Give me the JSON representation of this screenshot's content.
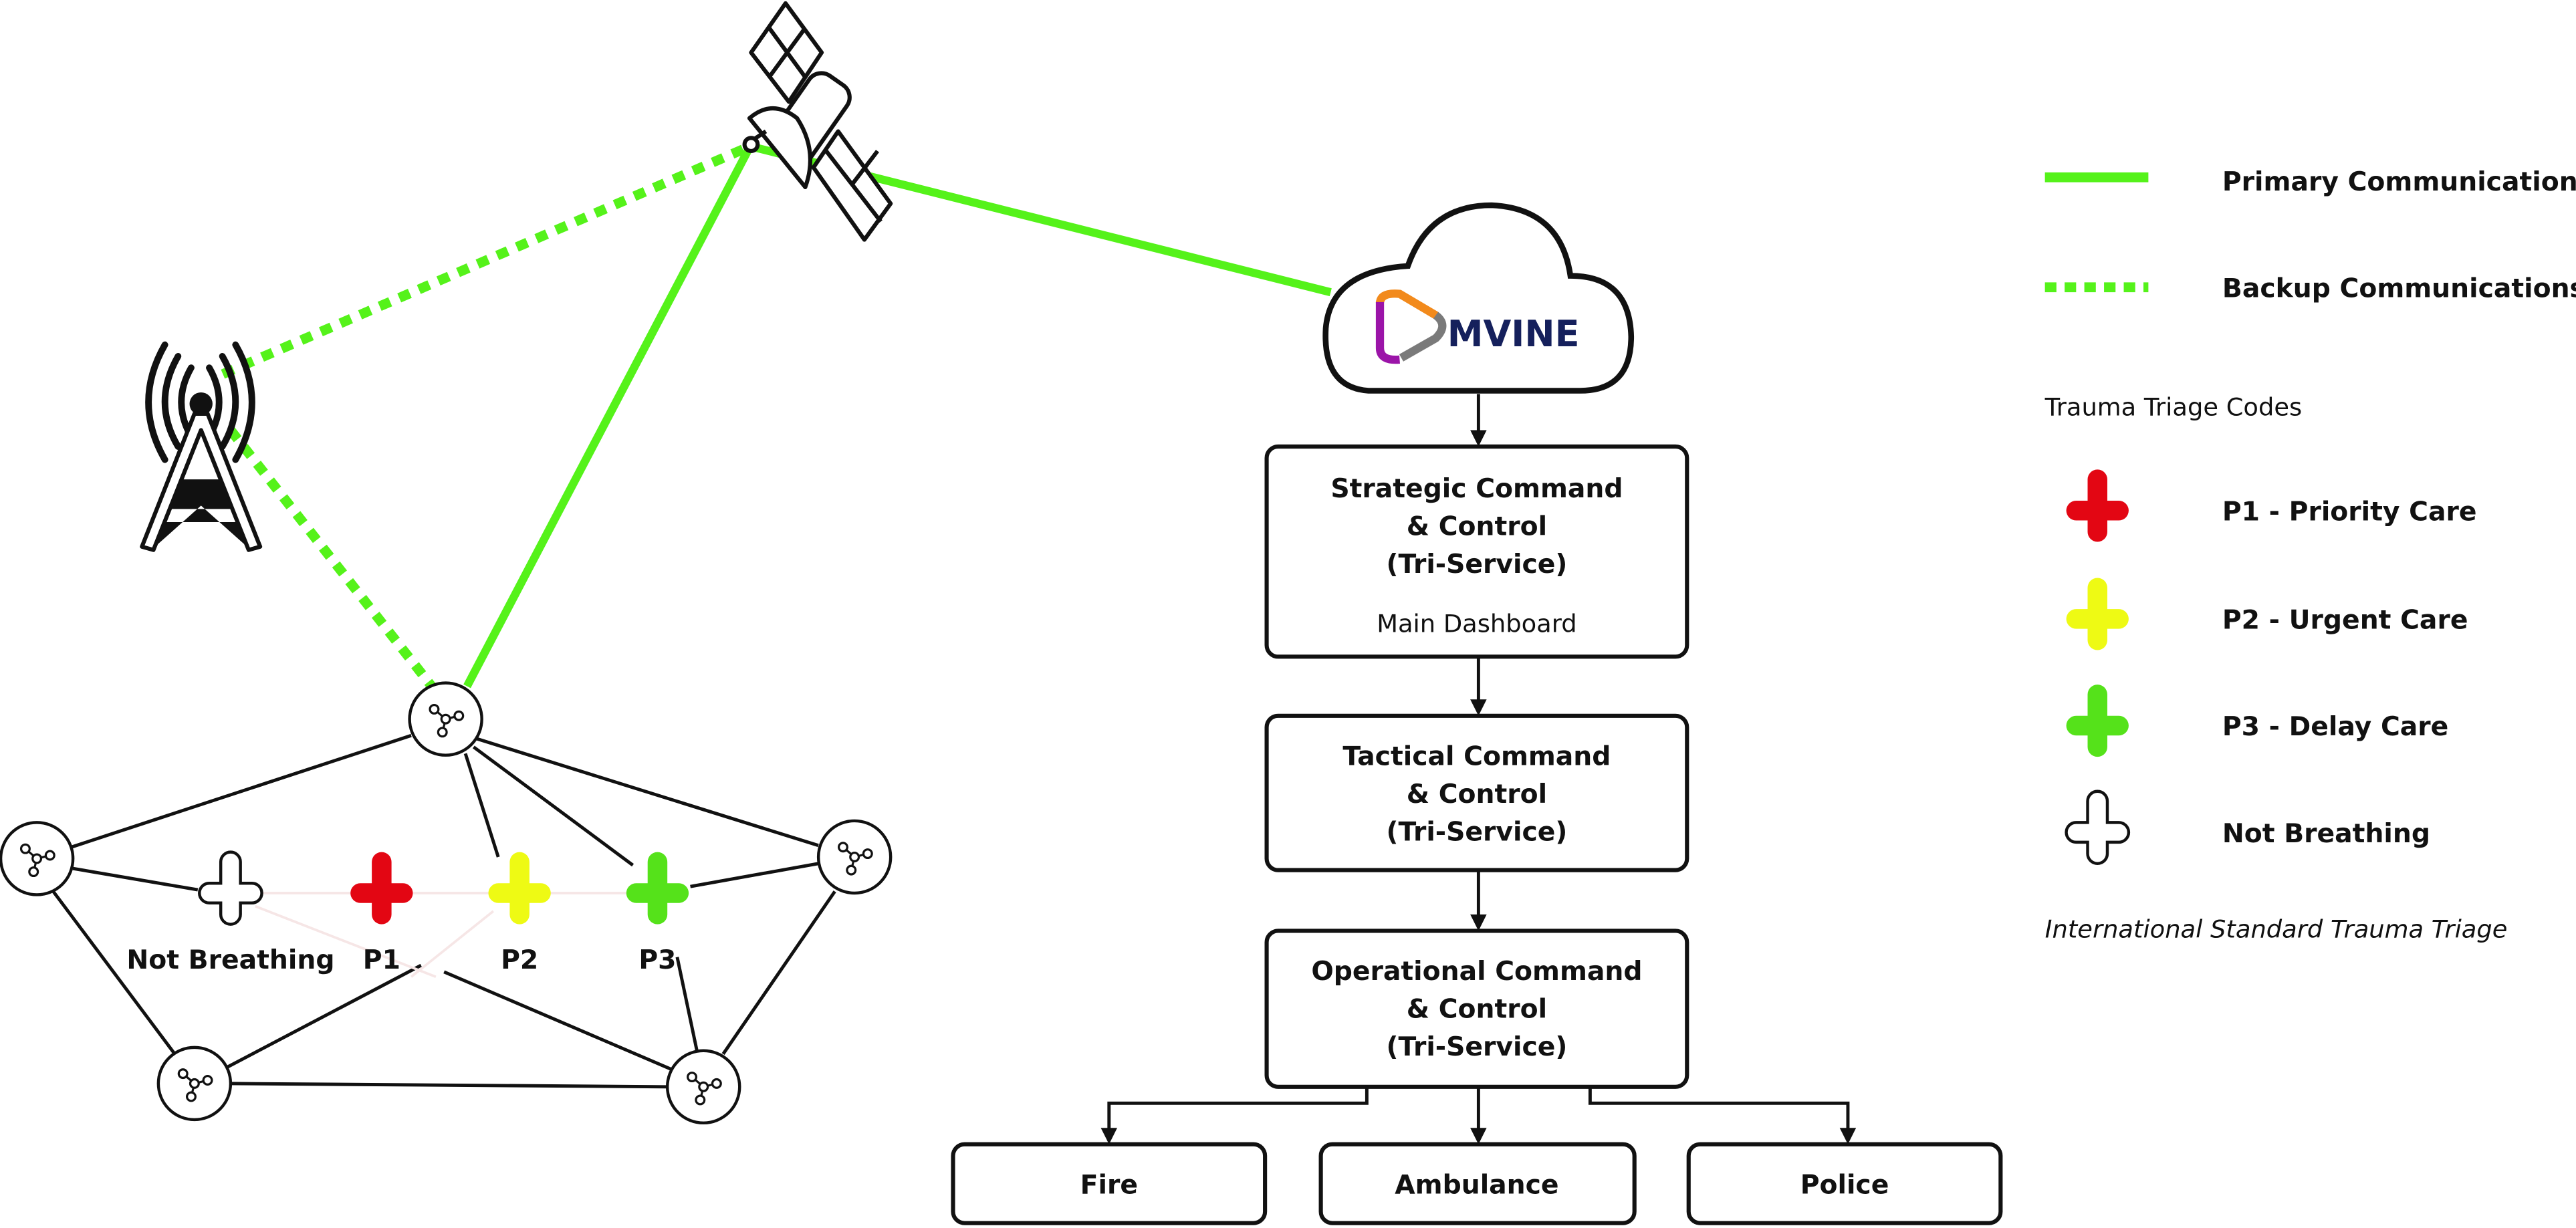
{
  "colors": {
    "primary_link": "#55f21a",
    "p1": "#e30613",
    "p2": "#eefa14",
    "p3": "#55e21a",
    "not_breathing": "#ffffff",
    "logo_text": "#15205c",
    "logo_orange": "#f28a1c",
    "logo_purple": "#9b14a8",
    "logo_grey": "#7a7a7a"
  },
  "cloud": {
    "logo_text": "MVINE"
  },
  "command": {
    "strategic": {
      "line1": "Strategic Command",
      "line2": "& Control",
      "line3": "(Tri-Service)",
      "sub": "Main Dashboard"
    },
    "tactical": {
      "line1": "Tactical Command",
      "line2": "& Control",
      "line3": "(Tri-Service)"
    },
    "operational": {
      "line1": "Operational Command",
      "line2": "& Control",
      "line3": "(Tri-Service)"
    }
  },
  "services": [
    "Fire",
    "Ambulance",
    "Police"
  ],
  "mesh": {
    "labels": [
      "Not Breathing",
      "P1",
      "P2",
      "P3"
    ]
  },
  "legend": {
    "primary": "Primary Communications",
    "backup": "Backup Communications",
    "triage_title": "Trauma Triage Codes",
    "codes": [
      "P1 - Priority Care",
      "P2 - Urgent Care",
      "P3 - Delay Care",
      "Not Breathing"
    ],
    "footnote": "International Standard Trauma Triage"
  },
  "icons": [
    "satellite-icon",
    "cell-tower-icon",
    "cloud-icon",
    "mesh-node-icon",
    "triage-cross-icon"
  ]
}
